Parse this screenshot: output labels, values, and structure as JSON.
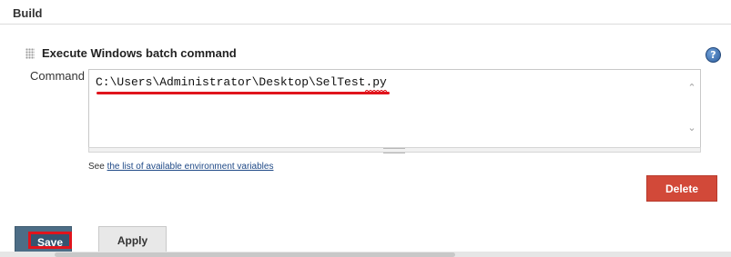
{
  "section": {
    "title": "Build"
  },
  "build_step": {
    "title": "Execute Windows batch command",
    "help_icon": "help-icon",
    "command_label": "Command",
    "command_value": "C:\\Users\\Administrator\\Desktop\\SelTest.py",
    "env_note_prefix": "See ",
    "env_note_link": "the list of available environment variables",
    "delete_label": "Delete"
  },
  "footer": {
    "save_label": "Save",
    "apply_label": "Apply"
  },
  "colors": {
    "accent_red": "#e0141c",
    "delete_bg": "#d24939",
    "save_bg": "#4d6d86",
    "link": "#204a87"
  }
}
